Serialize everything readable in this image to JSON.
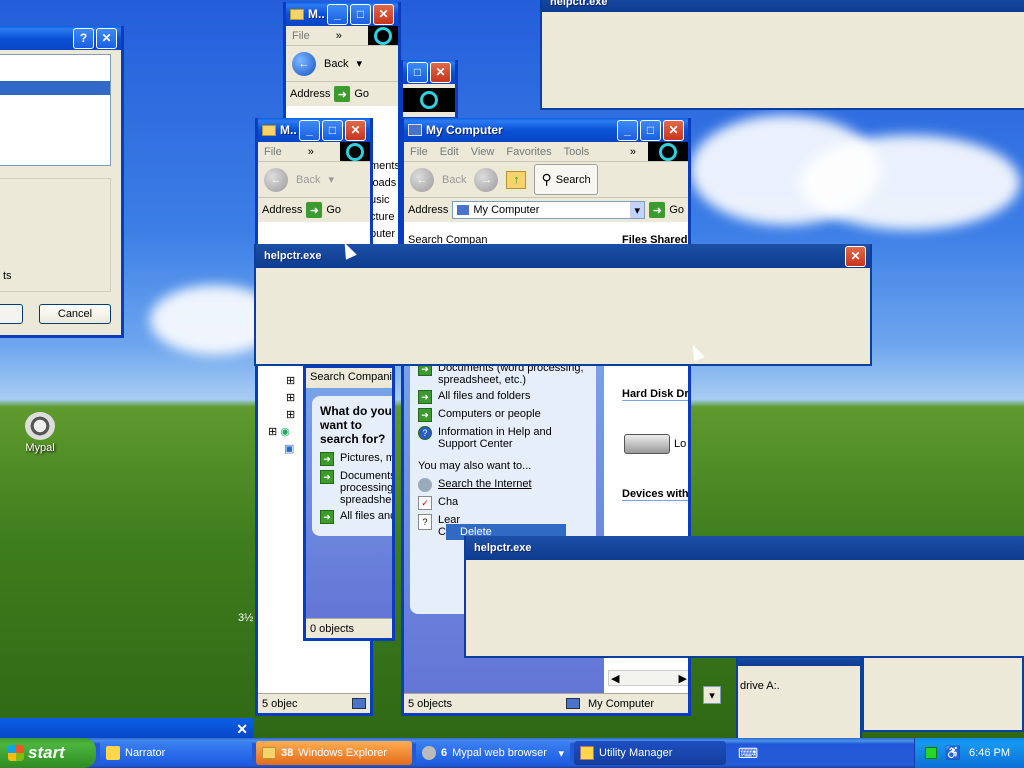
{
  "desktop": {
    "icon_label": "Mypal",
    "stray_text": "3½"
  },
  "dialog": {
    "cancel_label": "Cancel",
    "truncated_text": "ts"
  },
  "explorer_small1": {
    "title": "M...",
    "menu": "File",
    "back": "Back",
    "address": "Address",
    "go": "Go",
    "items": [
      "ments",
      "loads",
      "usic",
      "cture",
      "puter"
    ]
  },
  "explorer_small2": {
    "title": "M...",
    "menu": "File",
    "back": "Back",
    "address": "Address",
    "go": "Go",
    "status": "5 objec"
  },
  "mycomputer": {
    "title": "My Computer",
    "menu": [
      "File",
      "Edit",
      "View",
      "Favorites",
      "Tools"
    ],
    "back": "Back",
    "search": "Search",
    "address_label": "Address",
    "address_value": "My Computer",
    "go": "Go",
    "search_header": "Search Compan",
    "files_header": "Files Shared",
    "search_items": [
      "Documents (word processing, spreadsheet, etc.)",
      "All files and folders",
      "Computers or people",
      "Information in Help and Support Center"
    ],
    "also": "You may also want to...",
    "also_items": [
      "Search the Internet",
      "Cha",
      "Lear"
    ],
    "also_items_2": [
      "Com"
    ],
    "sections": [
      "Hard Disk Dr",
      "Devices with"
    ],
    "disk_label": "Lo",
    "status_left": "5 objects",
    "status_right": "My Computer"
  },
  "search_companion": {
    "header": "Search Companion",
    "question": "What do you want to search for?",
    "items": [
      "Pictures, m",
      "Documents processing spreadshee",
      "All files and"
    ],
    "status": "0 objects"
  },
  "context_menu": {
    "item": "Delete"
  },
  "helpctr_windows": [
    {
      "title": "helpctr.exe"
    },
    {
      "title": "helpctr.exe"
    },
    {
      "title": "helpctr.exe"
    }
  ],
  "drive_window": {
    "text": "drive A:."
  },
  "taskbar": {
    "start": "start",
    "buttons": [
      {
        "label": "Narrator"
      },
      {
        "count": "38",
        "label": "Windows Explorer"
      },
      {
        "count": "6",
        "label": "Mypal web browser"
      },
      {
        "label": "Utility Manager"
      }
    ],
    "clock": "6:46 PM"
  },
  "colors": {
    "xp_blue": "#0a52d6",
    "taskbar_active": "#e36b1c",
    "start_green": "#3c9a2f"
  }
}
